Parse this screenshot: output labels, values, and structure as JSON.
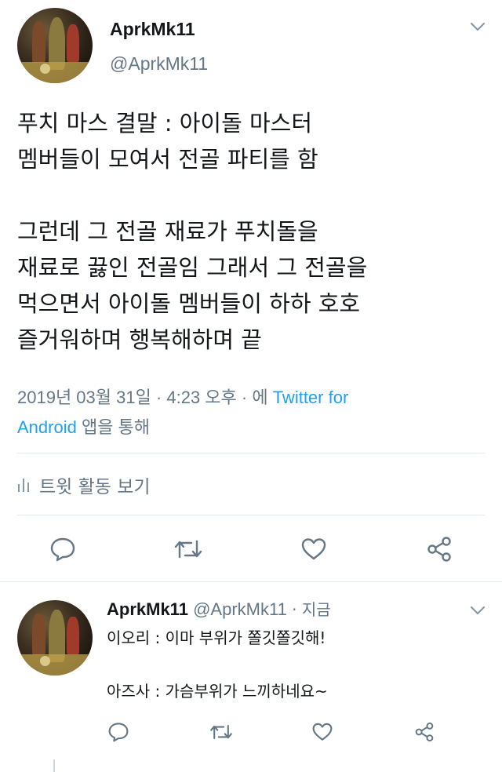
{
  "main_tweet": {
    "display_name": "AprkMk11",
    "handle": "@AprkMk11",
    "text": "푸치 마스 결말 : 아이돌 마스터\n멤버들이 모여서 전골 파티를 함\n\n그런데 그 전골 재료가 푸치돌을\n재료로 끓인 전골임 그래서 그 전골을\n먹으면서 아이돌 멤버들이 하하 호호\n즐거워하며 행복해하며 끝",
    "meta_prefix": "2019년 03월 31일 · 4:23 오후 · 에 ",
    "source_line1": "Twitter for",
    "source_line2": "Android",
    "meta_suffix": " 앱을 통해",
    "activity_label": "트윗 활동 보기"
  },
  "reply": {
    "display_name": "AprkMk11",
    "handle": "@AprkMk11",
    "time": " · 지금",
    "text": "이오리 : 이마 부위가 쫄깃쫄깃해!\n\n아즈사 : 가슴부위가 느끼하네요~"
  },
  "colors": {
    "accent": "#1da1f2",
    "secondary_text": "#657786",
    "divider": "#e1e8ed"
  },
  "icons": [
    "chevron-down-icon",
    "activity-bars-icon",
    "reply-icon",
    "retweet-icon",
    "like-icon",
    "share-icon"
  ]
}
